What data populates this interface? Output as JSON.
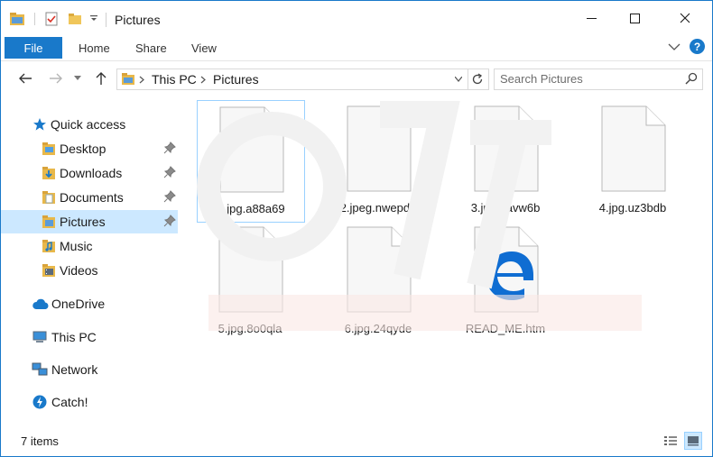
{
  "window": {
    "title": "Pictures"
  },
  "ribbon": {
    "file": "File",
    "home": "Home",
    "share": "Share",
    "view": "View",
    "help": "?"
  },
  "address": {
    "this_pc": "This PC",
    "current": "Pictures"
  },
  "search": {
    "placeholder": "Search Pictures"
  },
  "sidebar": {
    "quick_access": "Quick access",
    "items": [
      {
        "label": "Desktop",
        "icon": "desktop-icon",
        "pinned": true
      },
      {
        "label": "Downloads",
        "icon": "downloads-icon",
        "pinned": true
      },
      {
        "label": "Documents",
        "icon": "documents-icon",
        "pinned": true
      },
      {
        "label": "Pictures",
        "icon": "pictures-icon",
        "pinned": true,
        "selected": true
      },
      {
        "label": "Music",
        "icon": "music-icon",
        "pinned": false
      },
      {
        "label": "Videos",
        "icon": "videos-icon",
        "pinned": false
      }
    ],
    "onedrive": "OneDrive",
    "this_pc": "This PC",
    "network": "Network",
    "catch": "Catch!"
  },
  "files": [
    {
      "name": "1.jpg.a88a69",
      "type": "generic",
      "selected": true
    },
    {
      "name": "2.jpeg.nwepd8",
      "type": "generic"
    },
    {
      "name": "3.jpg.havw6b",
      "type": "generic"
    },
    {
      "name": "4.jpg.uz3bdb",
      "type": "generic"
    },
    {
      "name": "5.jpg.8o0qla",
      "type": "generic"
    },
    {
      "name": "6.jpg.24qyde",
      "type": "generic"
    },
    {
      "name": "READ_ME.htm",
      "type": "edge"
    }
  ],
  "status": {
    "count": "7 items"
  },
  "colors": {
    "accent": "#1979ca",
    "selection": "#cce8ff",
    "selection_border": "#99d1ff",
    "edge_blue": "#0f6dd2"
  }
}
